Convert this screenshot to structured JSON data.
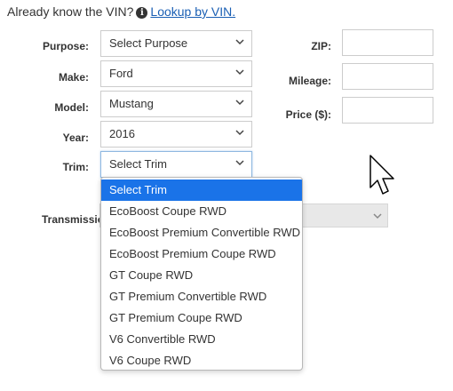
{
  "vin_prompt": {
    "text": "Already know the VIN?",
    "link": "Lookup by VIN.",
    "icon": "info-icon"
  },
  "form": {
    "purpose": {
      "label": "Purpose:",
      "value": "Select Purpose"
    },
    "make": {
      "label": "Make:",
      "value": "Ford"
    },
    "model": {
      "label": "Model:",
      "value": "Mustang"
    },
    "year": {
      "label": "Year:",
      "value": "2016"
    },
    "trim": {
      "label": "Trim:",
      "value": "Select Trim"
    },
    "zip": {
      "label": "ZIP:",
      "value": ""
    },
    "mileage": {
      "label": "Mileage:",
      "value": ""
    },
    "price": {
      "label": "Price ($):",
      "value": ""
    },
    "transmission": {
      "label": "Transmissio",
      "value": ""
    }
  },
  "trim_dropdown": {
    "selected_index": 0,
    "options": [
      "Select Trim",
      "EcoBoost Coupe RWD",
      "EcoBoost Premium Convertible RWD",
      "EcoBoost Premium Coupe RWD",
      "GT Coupe RWD",
      "GT Premium Convertible RWD",
      "GT Premium Coupe RWD",
      "V6 Convertible RWD",
      "V6 Coupe RWD"
    ]
  },
  "colors": {
    "highlight": "#1a73e8",
    "link": "#1a5fb4"
  }
}
